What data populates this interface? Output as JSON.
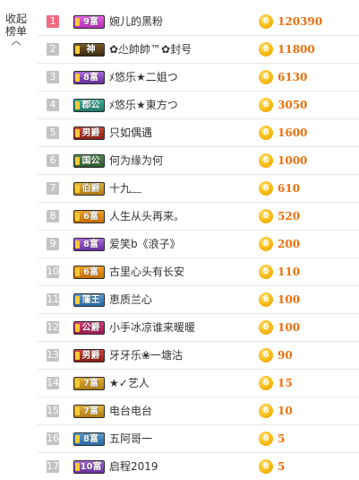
{
  "sidebar": {
    "collapse_label_1": "收起",
    "collapse_label_2": "榜单",
    "collapse_icon": "chevron-up-icon"
  },
  "coin_glyph": "6",
  "rows": [
    {
      "rank": "1",
      "badge": "9富",
      "badge_color": "pink",
      "name": "婉儿的黑粉",
      "score": "120390",
      "top": true
    },
    {
      "rank": "2",
      "badge": "神",
      "badge_color": "dark",
      "name": "✿尐帥帥™✿封号",
      "score": "11800",
      "top": false
    },
    {
      "rank": "3",
      "badge": "8富",
      "badge_color": "purple",
      "name": "ﾒ悠乐★二姐つ",
      "score": "6130",
      "top": false
    },
    {
      "rank": "4",
      "badge": "郡公",
      "badge_color": "teal",
      "name": "ﾒ悠乐★東方つ",
      "score": "3050",
      "top": false
    },
    {
      "rank": "5",
      "badge": "男爵",
      "badge_color": "red",
      "name": "只如偶遇",
      "score": "1600",
      "top": false
    },
    {
      "rank": "6",
      "badge": "国公",
      "badge_color": "green",
      "name": "何为缘为何",
      "score": "1000",
      "top": false
    },
    {
      "rank": "7",
      "badge": "伯爵",
      "badge_color": "gold",
      "name": "十九﹏",
      "score": "610",
      "top": false
    },
    {
      "rank": "8",
      "badge": "6富",
      "badge_color": "orange",
      "name": "人生从头再来。",
      "score": "520",
      "top": false
    },
    {
      "rank": "9",
      "badge": "8富",
      "badge_color": "purple",
      "name": "爱笑b《浪子》",
      "score": "200",
      "top": false
    },
    {
      "rank": "10",
      "badge": "6富",
      "badge_color": "orange",
      "name": "古里心头有长安",
      "score": "110",
      "top": false
    },
    {
      "rank": "11",
      "badge": "藩王",
      "badge_color": "blue",
      "name": "恵质兰心",
      "score": "100",
      "top": false
    },
    {
      "rank": "12",
      "badge": "公爵",
      "badge_color": "magenta",
      "name": "小手冰凉谁来暖暖",
      "score": "100",
      "top": false
    },
    {
      "rank": "13",
      "badge": "男爵",
      "badge_color": "red",
      "name": "牙牙乐❀一塘沽",
      "score": "90",
      "top": false
    },
    {
      "rank": "14",
      "badge": "7富",
      "badge_color": "gold",
      "name": "★✓艺人",
      "score": "15",
      "top": false
    },
    {
      "rank": "15",
      "badge": "7富",
      "badge_color": "gold",
      "name": "电台电台",
      "score": "10",
      "top": false
    },
    {
      "rank": "16",
      "badge": "8富",
      "badge_color": "blue",
      "name": "五阿哥一",
      "score": "5",
      "top": false
    },
    {
      "rank": "17",
      "badge": "10富",
      "badge_color": "purple",
      "name": "启程2019",
      "score": "5",
      "top": false
    }
  ]
}
